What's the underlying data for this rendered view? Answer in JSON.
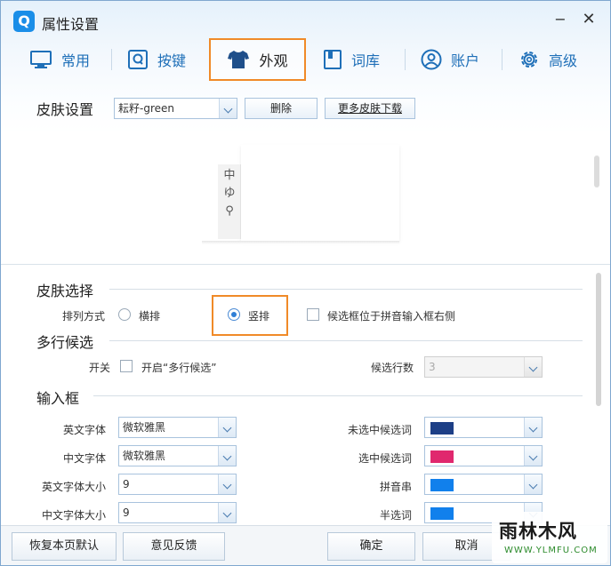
{
  "window": {
    "title": "属性设置",
    "logo_letter": "Q",
    "minimize": "−",
    "close": "✕"
  },
  "tabs": [
    {
      "label": "常用",
      "icon": "monitor-icon"
    },
    {
      "label": "按键",
      "icon": "key-q-icon"
    },
    {
      "label": "外观",
      "icon": "tshirt-icon",
      "active": true
    },
    {
      "label": "词库",
      "icon": "book-icon"
    },
    {
      "label": "账户",
      "icon": "user-icon"
    },
    {
      "label": "高级",
      "icon": "gear-icon"
    }
  ],
  "skin": {
    "section_title": "皮肤设置",
    "selected": "耘籽-green",
    "delete_label": "删除",
    "more_label": "更多皮肤下载"
  },
  "preview": {
    "ime_items": [
      "中",
      "ゆ",
      "⚲"
    ]
  },
  "skin_select": {
    "title": "皮肤选择",
    "arrange_label": "排列方式",
    "horizontal_label": "横排",
    "vertical_label": "竖排",
    "selected": "vertical",
    "candidate_right_label": "候选框位于拼音输入框右侧",
    "candidate_right_checked": false
  },
  "multiline": {
    "title": "多行候选",
    "switch_label": "开关",
    "enable_label": "开启“多行候选”",
    "enable_checked": false,
    "rows_label": "候选行数",
    "rows_value": "3"
  },
  "input_box": {
    "title": "输入框",
    "en_font_label": "英文字体",
    "en_font_value": "微软雅黑",
    "cn_font_label": "中文字体",
    "cn_font_value": "微软雅黑",
    "en_size_label": "英文字体大小",
    "en_size_value": "9",
    "cn_size_label": "中文字体大小",
    "cn_size_value": "9",
    "unselected_label": "未选中候选词",
    "unselected_color": "#1d3f86",
    "selected_label": "选中候选词",
    "selected_color": "#e0286e",
    "pinyin_label": "拼音串",
    "pinyin_color": "#1180ec",
    "half_label": "半选词",
    "half_color": "#1180ec"
  },
  "footer": {
    "reset_label": "恢复本页默认",
    "feedback_label": "意见反馈",
    "ok_label": "确定",
    "cancel_label": "取消"
  },
  "watermark": {
    "main": "雨林木风",
    "sub": "WWW.YLMFU.COM"
  }
}
